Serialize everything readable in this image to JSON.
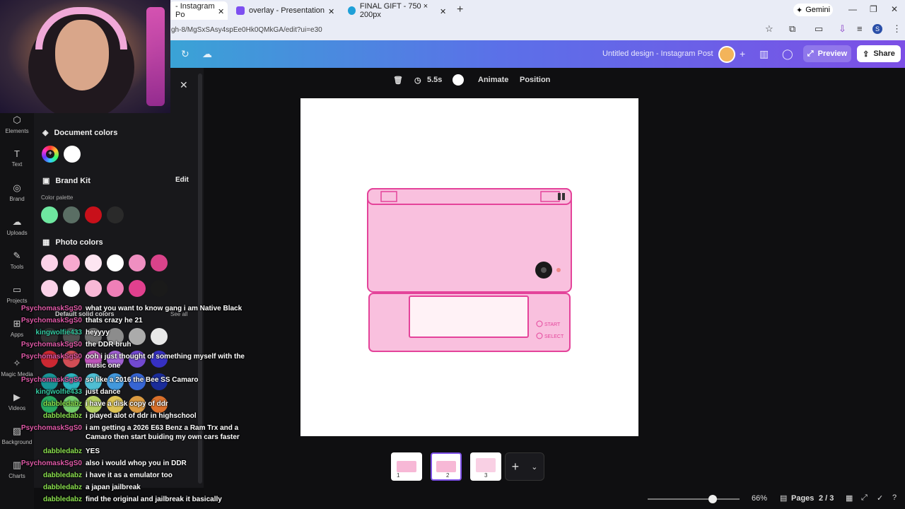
{
  "browser": {
    "tabs": [
      {
        "label": "- Instagram Po",
        "active": true
      },
      {
        "label": "overlay - Presentation",
        "active": false
      },
      {
        "label": "FINAL GIFT - 750 × 200px",
        "active": false
      }
    ],
    "gemini_label": "Gemini",
    "url": "gh-8/MgSxSAsy4spEe0Hk0QMkGA/edit?ui=e30",
    "profile_initial": "S"
  },
  "canva_header": {
    "design_title": "Untitled design - Instagram Post",
    "preview_label": "Preview",
    "share_label": "Share"
  },
  "context_toolbar": {
    "duration": "5.5s",
    "animate_label": "Animate",
    "position_label": "Position"
  },
  "left_rail": {
    "items": [
      "Elements",
      "Text",
      "Brand",
      "Uploads",
      "Tools",
      "Projects",
      "Apps",
      "Magic Media",
      "Videos",
      "Background",
      "Charts"
    ]
  },
  "color_panel": {
    "document_colors_label": "Document colors",
    "brand_kit_label": "Brand Kit",
    "edit_label": "Edit",
    "color_palette_label": "Color palette",
    "photo_colors_label": "Photo colors",
    "default_solid_label": "Default solid colors",
    "see_all_label": "See all",
    "document_colors": [
      "#ffffff"
    ],
    "brand_palette": [
      "#6ee7a0",
      "#5a6e64",
      "#c8101a",
      "#2a2a2a"
    ],
    "photo_colors_row1": [
      "#fbd2e8",
      "#f7a9cf",
      "#fde5f1",
      "#ffffff",
      "#ef8fc1",
      "#d9438a"
    ],
    "photo_colors_row2": [
      "#fbd2e8",
      "#ffffff",
      "#f7b8d6",
      "#ef7fb7",
      "#e1408e",
      "#1a1a1a"
    ]
  },
  "chat": [
    {
      "user": "PsychomaskSgS0",
      "text": "what you want to know gang i am Native Black",
      "color": "#e05aa8"
    },
    {
      "user": "PsychomaskSgS0",
      "text": "thats crazy he 21",
      "color": "#e05aa8"
    },
    {
      "user": "kingwolfie433",
      "text": "heyyyy",
      "color": "#34c8a0"
    },
    {
      "user": "PsychomaskSgS0",
      "text": "the DDR bruh",
      "color": "#e05aa8"
    },
    {
      "user": "PsychomaskSgS0",
      "text": "ooh i just thought of something myself with the music one",
      "color": "#e05aa8"
    },
    {
      "user": "PsychomaskSgS0",
      "text": "so like a 2016 the Bee SS Camaro",
      "color": "#e05aa8"
    },
    {
      "user": "kingwolfie433",
      "text": "just dance",
      "color": "#34c8a0"
    },
    {
      "user": "dabbledabz",
      "text": "i have a disk copy of ddr",
      "color": "#8be04e"
    },
    {
      "user": "dabbledabz",
      "text": "i played alot of ddr in highschool",
      "color": "#8be04e"
    },
    {
      "user": "PsychomaskSgS0",
      "text": "i am getting a 2026 E63 Benz a Ram Trx and a Camaro then start buiding my own cars faster",
      "color": "#e05aa8"
    },
    {
      "user": "dabbledabz",
      "text": "YES",
      "color": "#8be04e"
    },
    {
      "user": "PsychomaskSgS0",
      "text": "also i would whop you in DDR",
      "color": "#e05aa8"
    },
    {
      "user": "dabbledabz",
      "text": "i have it as a emulator too",
      "color": "#8be04e"
    },
    {
      "user": "dabbledabz",
      "text": "a japan jailbreak",
      "color": "#8be04e"
    },
    {
      "user": "dabbledabz",
      "text": "find the original and jailbreak it basically",
      "color": "#8be04e"
    }
  ],
  "canvas_art": {
    "device_body_color": "#f9c0de",
    "device_stroke_color": "#e4439a",
    "screen_color": "#fff2f6",
    "start_label": "START",
    "select_label": "SELECT"
  },
  "pages": {
    "thumbnails": [
      "1",
      "2",
      "3"
    ],
    "active_index": 2,
    "pages_label": "Pages",
    "page_counter": "2 / 3",
    "zoom": "66%",
    "zoom_level": 0.66
  }
}
